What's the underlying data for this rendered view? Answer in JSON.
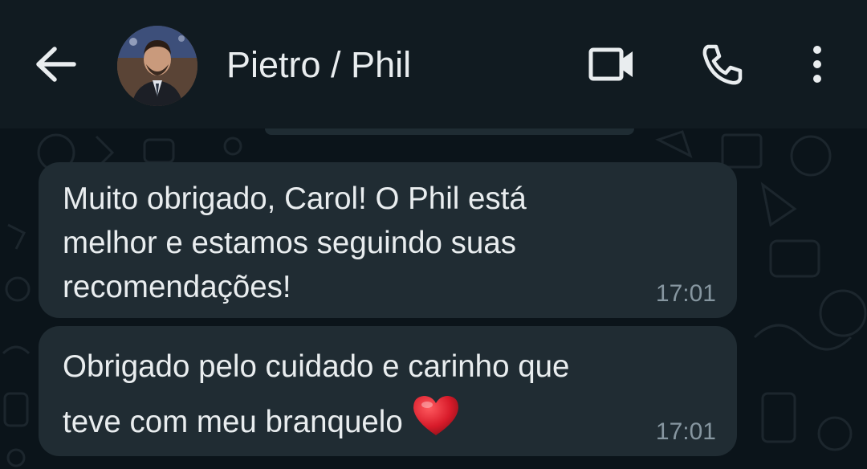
{
  "header": {
    "contact_name": "Pietro / Phil",
    "icons": {
      "back": "arrow-back-icon",
      "video": "video-call-icon",
      "call": "phone-icon",
      "menu": "more-vertical-icon"
    }
  },
  "messages": [
    {
      "text": "Muito obrigado, Carol! O Phil está\nmelhor e estamos seguindo suas\nrecomendações!",
      "time": "17:01"
    },
    {
      "text": "Obrigado pelo cuidado e carinho que\nteve com meu branquelo",
      "emoji": "heart-emoji",
      "time": "17:01"
    }
  ],
  "colors": {
    "header_bg": "#111b21",
    "chat_bg": "#0b141a",
    "bubble_bg": "#202c33",
    "text": "#e9edef",
    "timestamp": "#8696a0",
    "heart": "#d81b2a"
  }
}
